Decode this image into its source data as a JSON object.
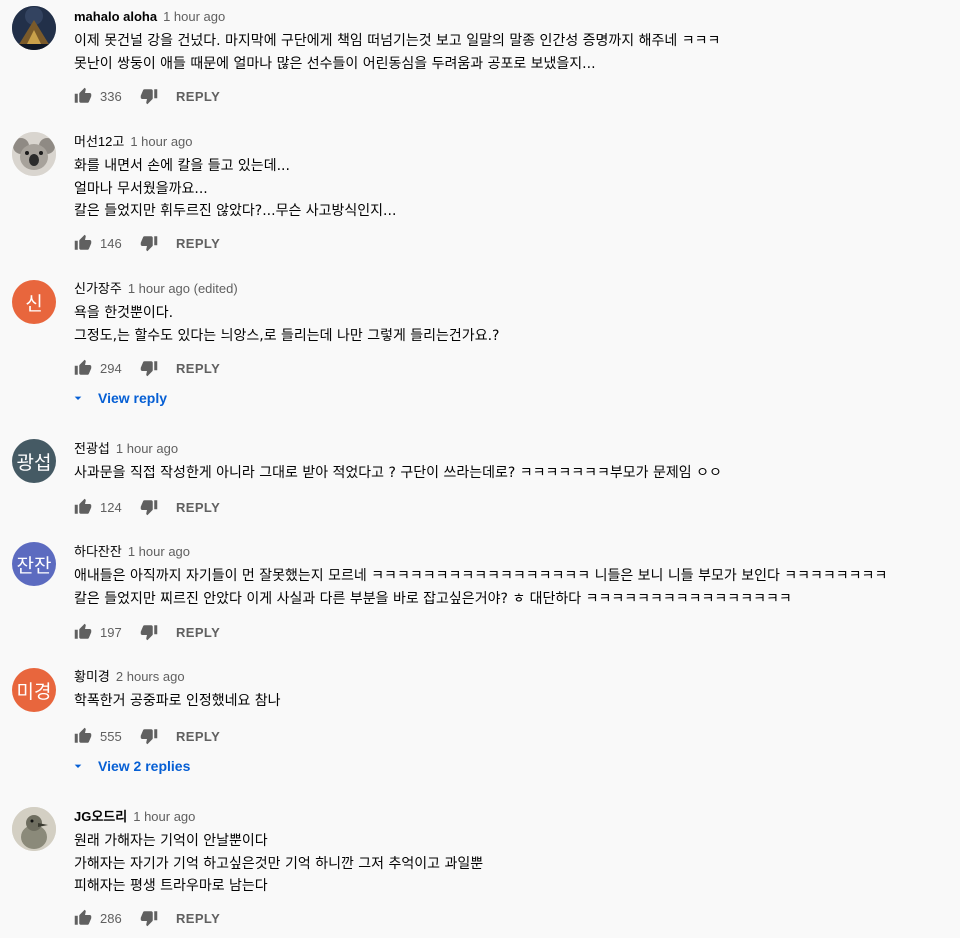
{
  "labels": {
    "reply": "REPLY"
  },
  "colors": {
    "link": "#065fd4",
    "secondary": "#606060",
    "background": "#f9f9f9"
  },
  "comments": [
    {
      "author": "mahalo aloha",
      "time": "1 hour ago",
      "text": "이제 못건널 강을 건넜다. 마지막에 구단에게 책임 떠넘기는것 보고 일말의 말종 인간성 증명까지 해주네 ㅋㅋㅋ\n못난이 쌍둥이 애들 때문에 얼마나 많은 선수들이 어린동심을 두려움과 공포로 보냈을지...",
      "likes": "336",
      "avatar": {
        "type": "image",
        "icon": "night-landscape"
      }
    },
    {
      "author": "머선12고",
      "time": "1 hour ago",
      "text": "화를 내면서 손에 칼을 들고 있는데...\n얼마나 무서웠을까요...\n칼은 들었지만 휘두르진 않았다?...무슨 사고방식인지...",
      "likes": "146",
      "avatar": {
        "type": "image",
        "icon": "koala"
      }
    },
    {
      "author": "신가장주",
      "time": "1 hour ago (edited)",
      "text": "욕을 한것뿐이다.\n그정도,는 할수도 있다는 늬앙스,로 들리는데 나만 그렇게 들리는건가요.?",
      "likes": "294",
      "avatar": {
        "type": "letter",
        "letter": "신",
        "color": "#e8663d"
      },
      "replies_label": "View reply"
    },
    {
      "author": "전광섭",
      "time": "1 hour ago",
      "text": "사과문을 직접 작성한게 아니라 그대로 받아 적었다고 ? 구단이 쓰라는데로? ㅋㅋㅋㅋㅋㅋㅋ부모가 문제임 ㅇㅇ",
      "likes": "124",
      "avatar": {
        "type": "letter",
        "letter": "광섭",
        "color": "#455a64"
      }
    },
    {
      "author": "하다잔잔",
      "time": "1 hour ago",
      "text": "애내들은 아직까지 자기들이 먼 잘못했는지 모르네 ㅋㅋㅋㅋㅋㅋㅋㅋㅋㅋㅋㅋㅋㅋㅋㅋㅋ  니들은 보니 니들 부모가 보인다 ㅋㅋㅋㅋㅋㅋㅋㅋ\n칼은 들었지만 찌르진 안았다  이게 사실과 다른 부분을 바로 잡고싶은거야?  ㅎ 대단하다 ㅋㅋㅋㅋㅋㅋㅋㅋㅋㅋㅋㅋㅋㅋㅋㅋ",
      "likes": "197",
      "avatar": {
        "type": "letter",
        "letter": "잔잔",
        "color": "#5c6bc0"
      }
    },
    {
      "author": "황미경",
      "time": "2 hours ago",
      "text": "학폭한거 공중파로 인정했네요 참나",
      "likes": "555",
      "avatar": {
        "type": "letter",
        "letter": "미경",
        "color": "#e8663d"
      },
      "replies_label": "View 2 replies"
    },
    {
      "author": "JG오드리",
      "time": "1 hour ago",
      "text": "원래 가해자는 기억이 안날뿐이다\n가해자는 자기가 기억 하고싶은것만 기억 하니깐 그저 추억이고 과일뿐\n피해자는 평생 트라우마로 남는다",
      "likes": "286",
      "avatar": {
        "type": "image",
        "icon": "bird"
      }
    }
  ]
}
